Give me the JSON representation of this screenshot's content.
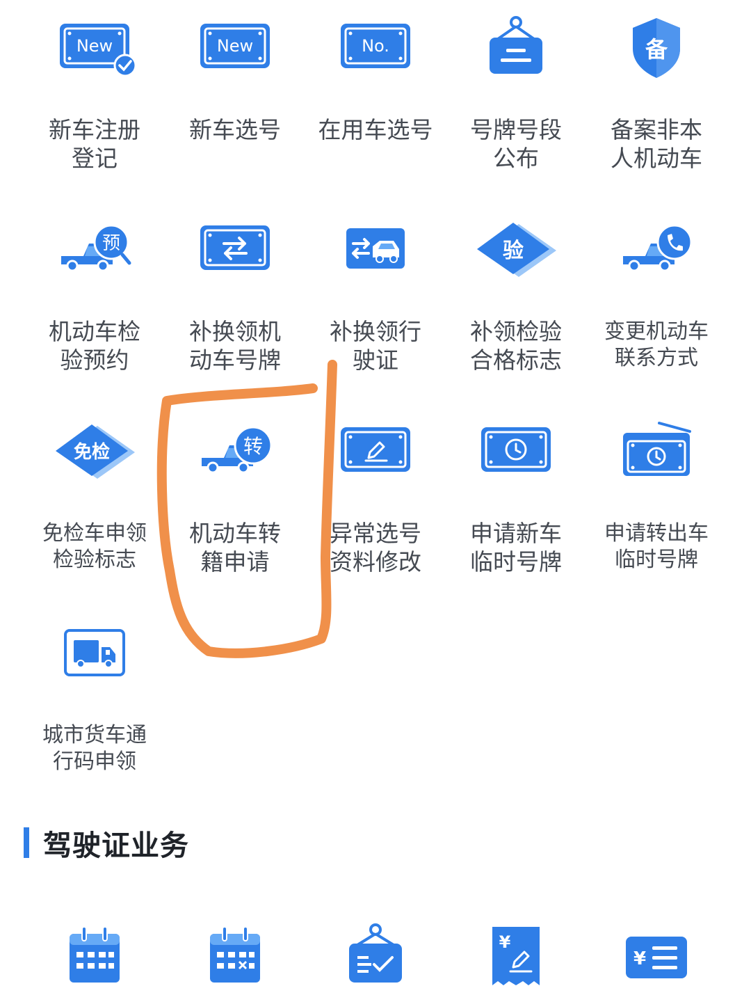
{
  "colors": {
    "primary": "#2f7ee7",
    "primary_light": "#66aaf6",
    "label": "#454a52",
    "title": "#1f2329",
    "annotation": "#f0904a"
  },
  "vehicle_services": [
    {
      "label": "新车注册\n登记",
      "icon": "new-plate-check-icon",
      "badge": "New"
    },
    {
      "label": "新车选号",
      "icon": "new-plate-icon",
      "badge": "New"
    },
    {
      "label": "在用车选号",
      "icon": "number-plate-icon",
      "badge": "No."
    },
    {
      "label": "号牌号段\n公布",
      "icon": "hanging-sign-icon"
    },
    {
      "label": "备案非本\n人机动车",
      "icon": "record-shield-icon",
      "badge": "备"
    },
    {
      "label": "机动车检\n验预约",
      "icon": "truck-appointment-icon",
      "badge": "预"
    },
    {
      "label": "补换领机\n动车号牌",
      "icon": "plate-exchange-icon"
    },
    {
      "label": "补换领行\n驶证",
      "icon": "license-exchange-icon"
    },
    {
      "label": "补领检验\n合格标志",
      "icon": "inspection-diamond-icon",
      "badge": "验"
    },
    {
      "label": "变更机动车\n联系方式",
      "icon": "truck-phone-icon"
    },
    {
      "label": "免检车申领\n检验标志",
      "icon": "exempt-diamond-icon",
      "badge": "免检"
    },
    {
      "label": "机动车转\n籍申请",
      "icon": "truck-transfer-icon",
      "badge": "转"
    },
    {
      "label": "异常选号\n资料修改",
      "icon": "plate-edit-icon"
    },
    {
      "label": "申请新车\n临时号牌",
      "icon": "temp-plate-clock-icon"
    },
    {
      "label": "申请转出车\n临时号牌",
      "icon": "temp-plate-radio-icon"
    },
    {
      "label": "城市货车通\n行码申领",
      "icon": "cargo-truck-icon"
    }
  ],
  "license_section": {
    "title": "驾驶证业务",
    "icons": [
      {
        "icon": "calendar-icon"
      },
      {
        "icon": "calendar-cancel-icon"
      },
      {
        "icon": "checklist-sign-icon"
      },
      {
        "icon": "fee-receipt-icon",
        "badge": "¥"
      },
      {
        "icon": "fee-list-icon",
        "badge": "¥"
      }
    ]
  }
}
